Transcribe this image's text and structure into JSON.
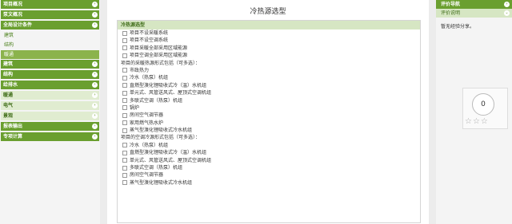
{
  "left_nav": {
    "items": [
      {
        "label": "项目概况",
        "type": "green"
      },
      {
        "label": "泵文概况",
        "type": "green"
      },
      {
        "label": "全局设计条件",
        "type": "green"
      },
      {
        "label": "建筑",
        "type": "sub"
      },
      {
        "label": "结构",
        "type": "sub"
      },
      {
        "label": "暖通",
        "type": "sub-active"
      },
      {
        "label": "建筑",
        "type": "green"
      },
      {
        "label": "结构",
        "type": "green"
      },
      {
        "label": "给排水",
        "type": "green"
      },
      {
        "label": "暖通",
        "type": "light"
      },
      {
        "label": "电气",
        "type": "light"
      },
      {
        "label": "景观",
        "type": "light"
      },
      {
        "label": "报表输出",
        "type": "green"
      },
      {
        "label": "专项计算",
        "type": "green"
      }
    ]
  },
  "main": {
    "title": "冷热源选型",
    "panel_title": "冷热源选型",
    "options": [
      {
        "kind": "opt",
        "label": "项目不设采暖系统"
      },
      {
        "kind": "opt",
        "label": "项目不设空调系统"
      },
      {
        "kind": "opt",
        "label": "项目采暖全部采用区域能源"
      },
      {
        "kind": "opt",
        "label": "项目空调全部采用区域能源"
      },
      {
        "kind": "group",
        "label": "项目的采暖热源形式包括（可多选）："
      },
      {
        "kind": "opt",
        "label": "市政热力"
      },
      {
        "kind": "opt",
        "label": "冷水（热泵）机组"
      },
      {
        "kind": "opt",
        "label": "直燃型溴化锂吸收式冷（温）水机组"
      },
      {
        "kind": "opt",
        "label": "单元式、风管送风式、屋顶式空调机组"
      },
      {
        "kind": "opt",
        "label": "多联式空调（热泵）机组"
      },
      {
        "kind": "opt",
        "label": "锅炉"
      },
      {
        "kind": "opt",
        "label": "房间空气调节器"
      },
      {
        "kind": "opt",
        "label": "家用燃气热水炉"
      },
      {
        "kind": "opt",
        "label": "蒸气型溴化锂吸收式冷水机组"
      },
      {
        "kind": "group",
        "label": "项目的空调冷源形式包括（可多选）："
      },
      {
        "kind": "opt",
        "label": "冷水（热泵）机组"
      },
      {
        "kind": "opt",
        "label": "直燃型溴化锂吸收式冷（温）水机组"
      },
      {
        "kind": "opt",
        "label": "单元式、风管送风式、屋顶式空调机组"
      },
      {
        "kind": "opt",
        "label": "多联式空调（热泵）机组"
      },
      {
        "kind": "opt",
        "label": "房间空气调节器"
      },
      {
        "kind": "opt",
        "label": "蒸气型溴化锂吸收式冷水机组"
      }
    ]
  },
  "right": {
    "header": "评价导航",
    "sub_header": "评价说明",
    "note": "暂无经验分享。",
    "score": "0",
    "stars": "☆☆☆"
  },
  "colors": {
    "accent": "#6a9f2f",
    "light": "#d6e6c3"
  }
}
